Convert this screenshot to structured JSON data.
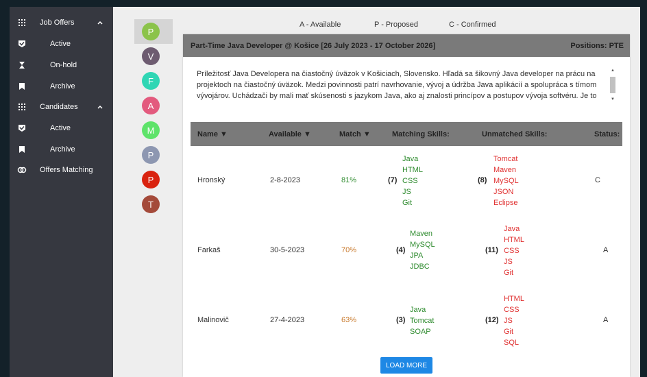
{
  "sidebar": {
    "job_offers": "Job Offers",
    "job_active": "Active",
    "job_onhold": "On-hold",
    "job_archive": "Archive",
    "candidates": "Candidates",
    "cand_active": "Active",
    "cand_archive": "Archive",
    "offers_matching": "Offers Matching"
  },
  "avatars": [
    {
      "letter": "P",
      "color": "#8bc34a"
    },
    {
      "letter": "V",
      "color": "#6d5b70"
    },
    {
      "letter": "F",
      "color": "#2fd6b4"
    },
    {
      "letter": "A",
      "color": "#e35a7e"
    },
    {
      "letter": "M",
      "color": "#5ee36a"
    },
    {
      "letter": "P",
      "color": "#8d97b1"
    },
    {
      "letter": "P",
      "color": "#d9230f"
    },
    {
      "letter": "T",
      "color": "#a44a3a"
    }
  ],
  "legend": {
    "available": "A - Available",
    "proposed": "P - Proposed",
    "confirmed": "C - Confirmed"
  },
  "offer": {
    "title": "Part-Time Java Developer @ Košice [26 July 2023 - 17 October 2026]",
    "positions": "Positions: PTE",
    "description": "Príležitosť Java Developera na čiastočný úväzok v Košiciach, Slovensko. Hľadá sa šikovný Java developer na prácu na projektoch na čiastočný úväzok. Medzi povinnosti patrí navrhovanie, vývoj a údržba Java aplikácií a spolupráca s tímom vývojárov. Uchádzači by mali mať skúsenosti s jazykom Java, ako aj znalosti princípov a postupov vývoja softvéru. Je to skvelá príležitosť pre niekoho, kto hľadá flexibilnú prácu s možnosťou rastu."
  },
  "table": {
    "headers": {
      "name": "Name ▼",
      "available": "Available ▼",
      "match": "Match ▼",
      "matching": "Matching Skills:",
      "unmatched": "Unmatched Skills:",
      "status": "Status:"
    },
    "rows": [
      {
        "name": "Hronský",
        "available": "2-8-2023",
        "match": "81%",
        "match_color": "#2e8b2e",
        "matching_count": "(7)",
        "matching": [
          "Java",
          "HTML",
          "CSS",
          "JS",
          "Git"
        ],
        "unmatched_count": "(8)",
        "unmatched": [
          "Tomcat",
          "Maven",
          "MySQL",
          "JSON",
          "Eclipse"
        ],
        "status": "C"
      },
      {
        "name": "Farkaš",
        "available": "30-5-2023",
        "match": "70%",
        "match_color": "#c8782a",
        "matching_count": "(4)",
        "matching": [
          "Maven",
          "MySQL",
          "JPA",
          "JDBC"
        ],
        "unmatched_count": "(11)",
        "unmatched": [
          "Java",
          "HTML",
          "CSS",
          "JS",
          "Git"
        ],
        "status": "A"
      },
      {
        "name": "Malinovič",
        "available": "27-4-2023",
        "match": "63%",
        "match_color": "#c8782a",
        "matching_count": "(3)",
        "matching": [
          "Java",
          "Tomcat",
          "SOAP"
        ],
        "unmatched_count": "(12)",
        "unmatched": [
          "HTML",
          "CSS",
          "JS",
          "Git",
          "SQL"
        ],
        "status": "A"
      }
    ]
  },
  "load_more": "LOAD MORE"
}
